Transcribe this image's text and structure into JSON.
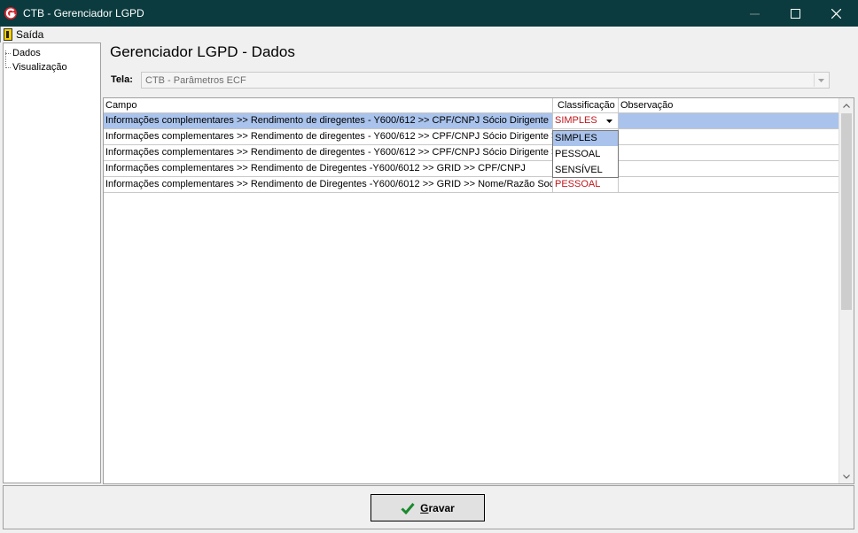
{
  "window": {
    "title": "CTB - Gerenciador LGPD",
    "titlebar_color": "#0b3b3e",
    "controls": [
      "minimize-icon",
      "maximize-icon",
      "close-icon"
    ]
  },
  "menu": {
    "exit_label": "Saída",
    "exit_icon": "exit-door-icon"
  },
  "tree": {
    "items": [
      {
        "label": "Dados"
      },
      {
        "label": "Visualização"
      }
    ]
  },
  "main": {
    "title": "Gerenciador LGPD - Dados",
    "tela_label": "Tela:",
    "tela_value": "CTB - Parâmetros ECF"
  },
  "grid": {
    "columns": [
      "Campo",
      "Classificação",
      "Observação"
    ],
    "rows": [
      {
        "campo": "Informações complementares >> Rendimento de diregentes - Y600/612 >> CPF/CNPJ Sócio Dirigente",
        "classificacao": "SIMPLES",
        "observacao": ""
      },
      {
        "campo": "Informações complementares >> Rendimento de diregentes - Y600/612 >> CPF/CNPJ Sócio Dirigente >...",
        "classificacao": "",
        "observacao": ""
      },
      {
        "campo": "Informações complementares >> Rendimento de diregentes - Y600/612 >> CPF/CNPJ Sócio Dirigente >...",
        "classificacao": "",
        "observacao": ""
      },
      {
        "campo": "Informações complementares >> Rendimento de Diregentes -Y600/6012 >> GRID >> CPF/CNPJ",
        "classificacao": "",
        "observacao": ""
      },
      {
        "campo": "Informações complementares >> Rendimento de Diregentes -Y600/6012 >> GRID >> Nome/Razão Social",
        "classificacao": "PESSOAL",
        "observacao": ""
      }
    ],
    "dropdown_options": [
      "SIMPLES",
      "PESSOAL",
      "SENSÍVEL"
    ],
    "dropdown_highlighted": "SIMPLES",
    "colors": {
      "selected_row": "#a9c3ec",
      "classification_text": "#c0161b"
    }
  },
  "footer": {
    "save_label": "Gravar"
  }
}
